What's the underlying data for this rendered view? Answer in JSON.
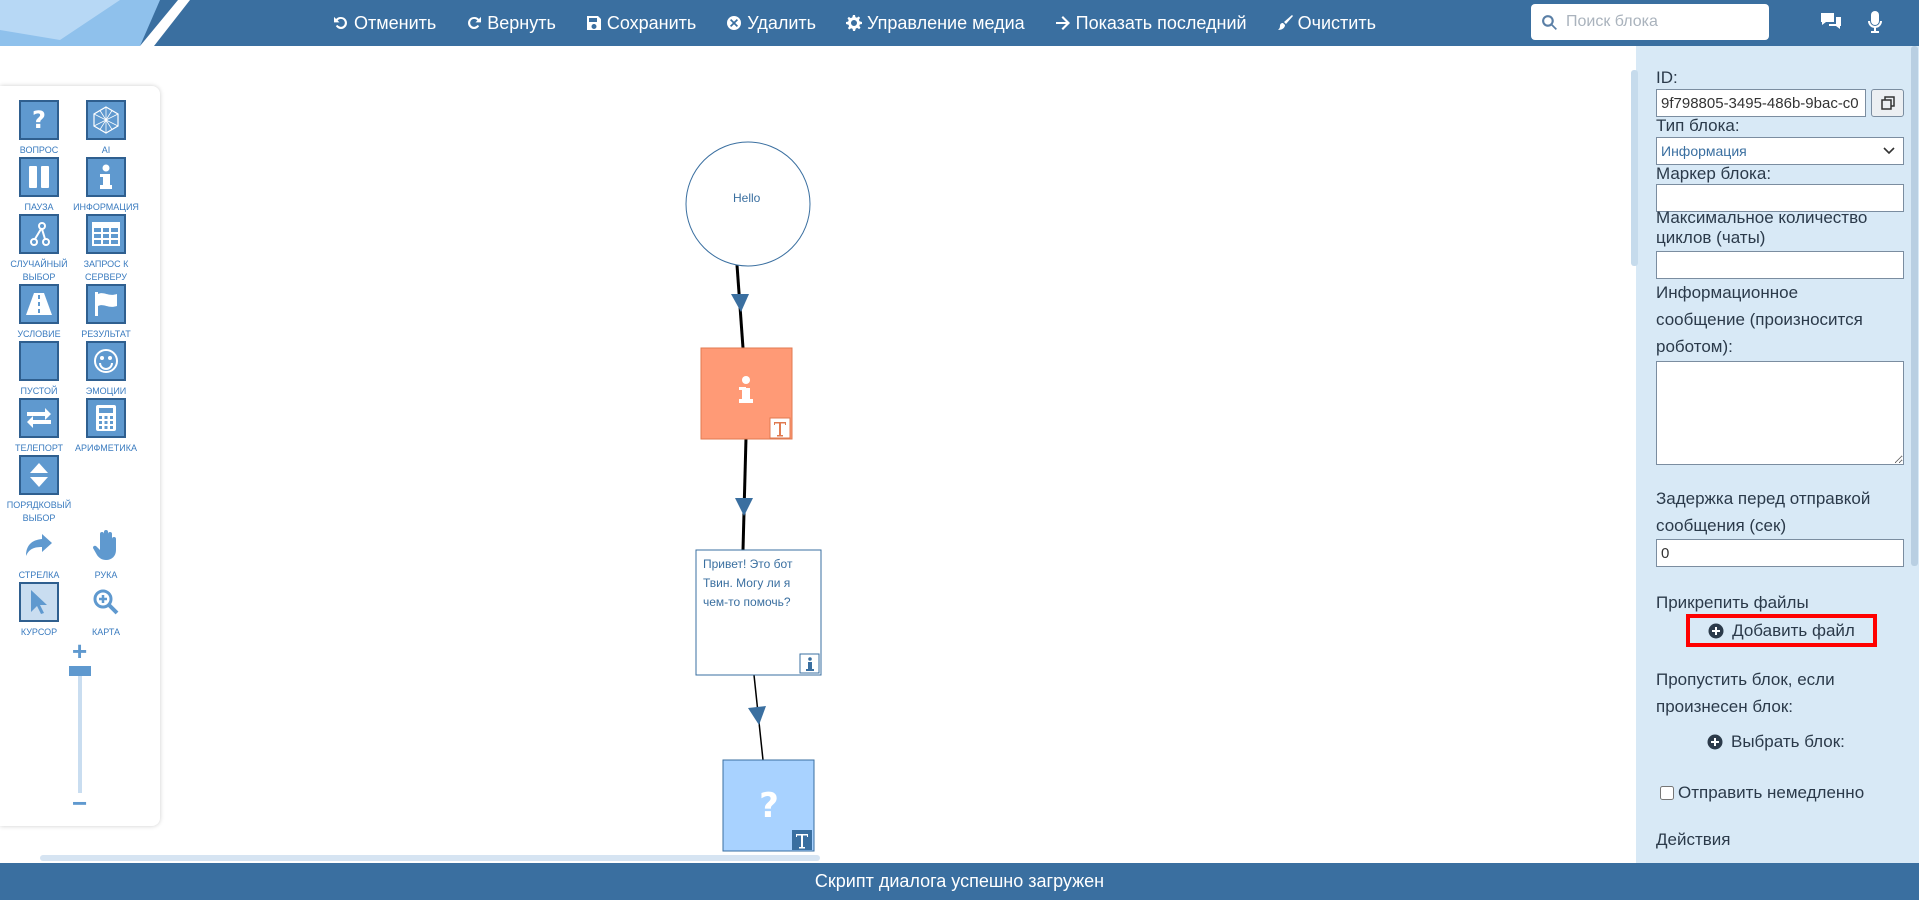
{
  "toolbar": {
    "undo_label": "Отменить",
    "redo_label": "Вернуть",
    "save_label": "Сохранить",
    "delete_label": "Удалить",
    "media_label": "Управление медиа",
    "show_last_label": "Показать последний",
    "clear_label": "Очистить"
  },
  "search": {
    "placeholder": "Поиск блока"
  },
  "tools": {
    "question": "Вопрос",
    "ai": "AI",
    "pause": "Пауза",
    "info": "Информация",
    "random_line1": "Случайный",
    "random_line2": "выбор",
    "server_line1": "Запрос к",
    "server_line2": "серверу",
    "condition": "Условие",
    "result": "Результат",
    "empty": "Пустой",
    "emotions": "Эмоции",
    "teleport": "Телепорт",
    "arithmetic": "Арифметика",
    "ordinal_line1": "Порядковый",
    "ordinal_line2": "выбор",
    "arrow": "Стрелка",
    "hand": "Рука",
    "cursor": "Курсор",
    "map": "Карта",
    "zoom_plus": "+",
    "zoom_minus": "−"
  },
  "canvas": {
    "start_node_text": "Hello",
    "message_text_line1": "Привет! Это бот",
    "message_text_line2": "Твин. Могу ли я",
    "message_text_line3": "чем-то помочь?"
  },
  "panel": {
    "id_label": "ID:",
    "id_value": "9f798805-3495-486b-9bac-c0",
    "block_type_label": "Тип блока:",
    "block_type_value": "Информация",
    "marker_label": "Маркер блока:",
    "marker_value": "",
    "max_cycles_line1": "Максимальное количество",
    "max_cycles_line2": "циклов (чаты)",
    "max_cycles_value": "",
    "info_msg_line1": "Информационное",
    "info_msg_line2": "сообщение (произносится",
    "info_msg_line3": "роботом):",
    "delay_line1": "Задержка перед отправкой",
    "delay_line2": "сообщения (сек)",
    "delay_value": "0",
    "attach_label": "Прикрепить файлы",
    "add_file_label": "Добавить файл",
    "skip_line1": "Пропустить блок, если",
    "skip_line2": "произнесен блок:",
    "choose_block_label": "Выбрать блок:",
    "send_now_label": "Отправить немедленно",
    "actions_label": "Действия"
  },
  "status": {
    "message": "Скрипт диалога успешно загружен"
  },
  "colors": {
    "primary": "#3a6fa0",
    "info_node": "#ff9a76",
    "question_node": "#a8d2ff",
    "panel_bg": "#d8e9f6",
    "highlight": "#ff0000"
  }
}
